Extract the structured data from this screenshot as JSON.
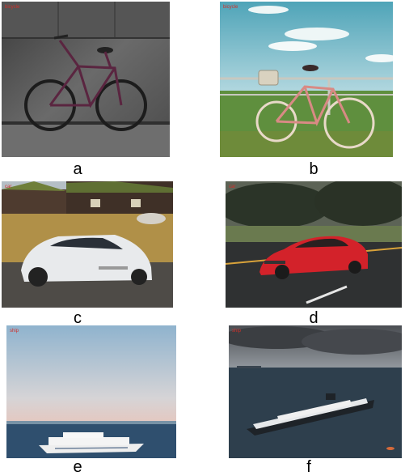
{
  "panels": [
    {
      "label": "a",
      "subject": "bicycle leaning on concrete wall",
      "watermark": "bicycle"
    },
    {
      "label": "b",
      "subject": "bicycle with basket by railing",
      "watermark": "bicycle"
    },
    {
      "label": "c",
      "subject": "white sports car by wooden houses",
      "watermark": "car"
    },
    {
      "label": "d",
      "subject": "red car on road",
      "watermark": "car"
    },
    {
      "label": "e",
      "subject": "white ship at sea",
      "watermark": "ship"
    },
    {
      "label": "f",
      "subject": "cruise ship under cloudy sky",
      "watermark": "ship"
    }
  ],
  "colors": {
    "caption": "#000000",
    "watermark": "#d0302a"
  }
}
